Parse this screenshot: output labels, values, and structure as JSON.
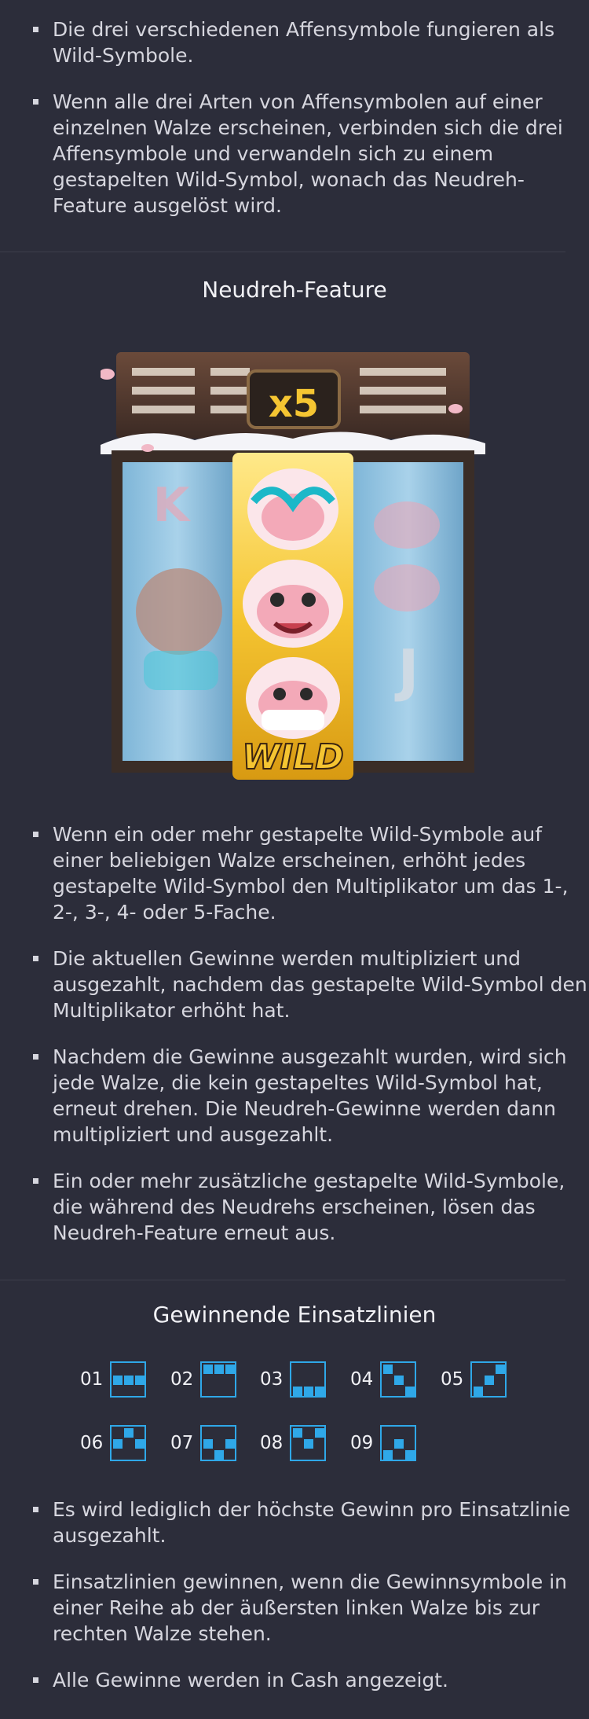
{
  "section1": {
    "bullets": [
      "Die drei verschiedenen Affensymbole fungieren als Wild-Symbole.",
      "Wenn alle drei Arten von Affensymbolen auf einer einzelnen Walze erscheinen, verbinden sich die drei Affensymbole und verwandeln sich zu einem gestapelten Wild-Symbol, wonach das Neudreh-Feature ausgelöst wird."
    ]
  },
  "respin": {
    "title": "Neudreh-Feature",
    "image": {
      "multiplier": "x5",
      "wild_label": "WILD",
      "reel_letters": [
        "K",
        "J"
      ]
    },
    "bullets": [
      "Wenn ein oder mehr gestapelte Wild-Symbole auf einer beliebigen Walze erscheinen, erhöht jedes gestapelte Wild-Symbol den Multiplikator um das 1-, 2-, 3-, 4- oder 5-Fache.",
      "Die aktuellen Gewinne werden multipliziert und ausgezahlt, nachdem das gestapelte Wild-Symbol den Multiplikator erhöht hat.",
      "Nachdem die Gewinne ausgezahlt wurden, wird sich jede Walze, die kein gestapeltes Wild-Symbol hat, erneut drehen. Die Neudreh-Gewinne werden dann multipliziert und ausgezahlt.",
      "Ein oder mehr zusätzliche gestapelte Wild-Symbole, die während des Neudrehs erscheinen, lösen das Neudreh-Feature erneut aus."
    ]
  },
  "paylines": {
    "title": "Gewinnende Einsatzlinien",
    "accent": "#2fa8e8",
    "items": [
      {
        "label": "01",
        "rows": [
          1,
          1,
          1
        ]
      },
      {
        "label": "02",
        "rows": [
          0,
          0,
          0
        ]
      },
      {
        "label": "03",
        "rows": [
          2,
          2,
          2
        ]
      },
      {
        "label": "04",
        "rows": [
          0,
          1,
          2
        ]
      },
      {
        "label": "05",
        "rows": [
          2,
          1,
          0
        ]
      },
      {
        "label": "06",
        "rows": [
          1,
          0,
          1
        ]
      },
      {
        "label": "07",
        "rows": [
          1,
          2,
          1
        ]
      },
      {
        "label": "08",
        "rows": [
          0,
          1,
          0
        ]
      },
      {
        "label": "09",
        "rows": [
          2,
          1,
          2
        ]
      }
    ],
    "bullets": [
      "Es wird lediglich der höchste Gewinn pro Einsatzlinie ausgezahlt.",
      "Einsatzlinien gewinnen, wenn die Gewinnsymbole in einer Reihe ab der äußersten linken Walze bis zur rechten Walze stehen.",
      "Alle Gewinne werden in Cash angezeigt."
    ]
  }
}
